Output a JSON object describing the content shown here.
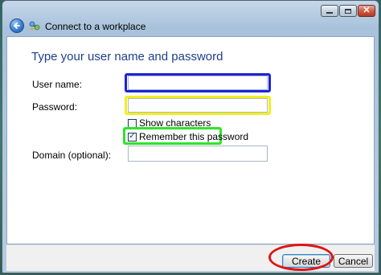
{
  "window": {
    "title": "Connect to a workplace",
    "controls": {
      "minimize_icon": "minimize-icon",
      "maximize_icon": "maximize-icon",
      "close_icon": "close-icon",
      "close_glyph": "✕"
    }
  },
  "page": {
    "heading": "Type your user name and password"
  },
  "form": {
    "username": {
      "label": "User name:",
      "value": ""
    },
    "password": {
      "label": "Password:",
      "value": ""
    },
    "show_characters": {
      "label": "Show characters",
      "checked": false,
      "mark": ""
    },
    "remember_password": {
      "label": "Remember this password",
      "checked": true,
      "mark": "✓"
    },
    "domain": {
      "label": "Domain (optional):",
      "value": ""
    }
  },
  "buttons": {
    "create": "Create",
    "cancel": "Cancel"
  },
  "highlights": {
    "username": "#1c24d6",
    "password": "#f0ef1c",
    "remember": "#2ee32a",
    "create": "#e01414"
  },
  "colors": {
    "heading": "#1e3f8a",
    "accent": "#3d7fd0"
  }
}
